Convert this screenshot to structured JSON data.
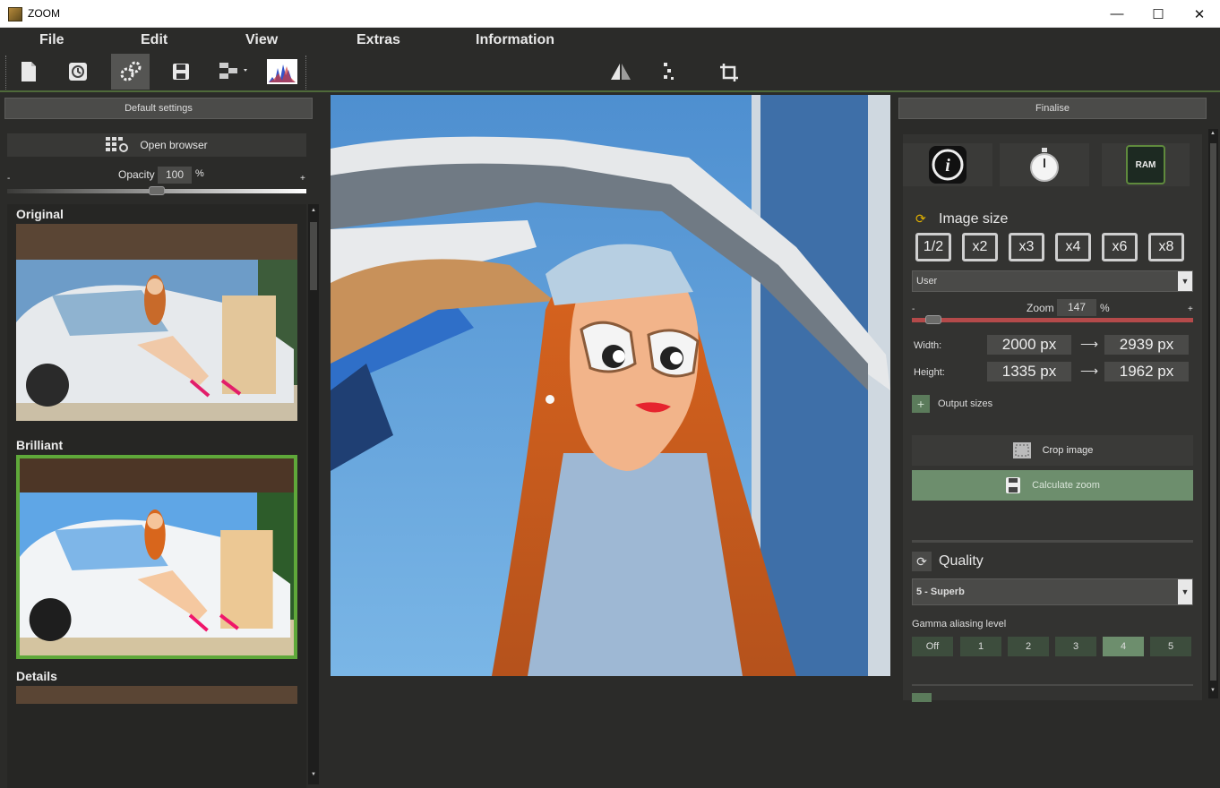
{
  "window": {
    "title": "ZOOM",
    "minimize": "—",
    "maximize": "☐",
    "close": "✕"
  },
  "menu": {
    "file": "File",
    "edit": "Edit",
    "view": "View",
    "extras": "Extras",
    "information": "Information"
  },
  "toolbar": {
    "icons": [
      "new-document-icon",
      "history-icon",
      "settings-gears-icon",
      "save-icon",
      "batch-dropdown-icon",
      "histogram-icon",
      "flip-icon",
      "compare-icon",
      "rotate-icon"
    ]
  },
  "left": {
    "header": "Default settings",
    "open_browser": "Open browser",
    "opacity_label": "Opacity",
    "opacity_value": "100",
    "opacity_unit": "%",
    "opacity_min": "-",
    "opacity_max": "+",
    "opacity_level": 0.5,
    "presets": [
      {
        "label": "Original"
      },
      {
        "label": "Brilliant",
        "selected": true
      },
      {
        "label": "Details"
      }
    ]
  },
  "right": {
    "header": "Finalise",
    "ram_label": "RAM",
    "image_size_title": "Image size",
    "multipliers": [
      "1/2",
      "x2",
      "x3",
      "x4",
      "x6",
      "x8"
    ],
    "size_mode": "User",
    "zoom_label": "Zoom",
    "zoom_value": "147",
    "zoom_unit": "%",
    "zoom_min": "-",
    "zoom_max": "+",
    "zoom_level": 0.05,
    "width_label": "Width:",
    "width_from": "2000 px",
    "width_to": "2939 px",
    "height_label": "Height:",
    "height_from": "1335 px",
    "height_to": "1962 px",
    "arrow": "⟶",
    "output_sizes_plus": "+",
    "output_sizes": "Output sizes",
    "crop_image": "Crop image",
    "calculate_zoom": "Calculate zoom",
    "quality_title": "Quality",
    "quality_value": "5 - Superb",
    "gamma_label": "Gamma aliasing level",
    "gamma_options": [
      "Off",
      "1",
      "2",
      "3",
      "4",
      "5"
    ],
    "gamma_selected": "4"
  },
  "colors": {
    "accent_green": "#5f8a3d",
    "selected_green": "#6d8e6d",
    "slider_red": "#b44a4a"
  }
}
